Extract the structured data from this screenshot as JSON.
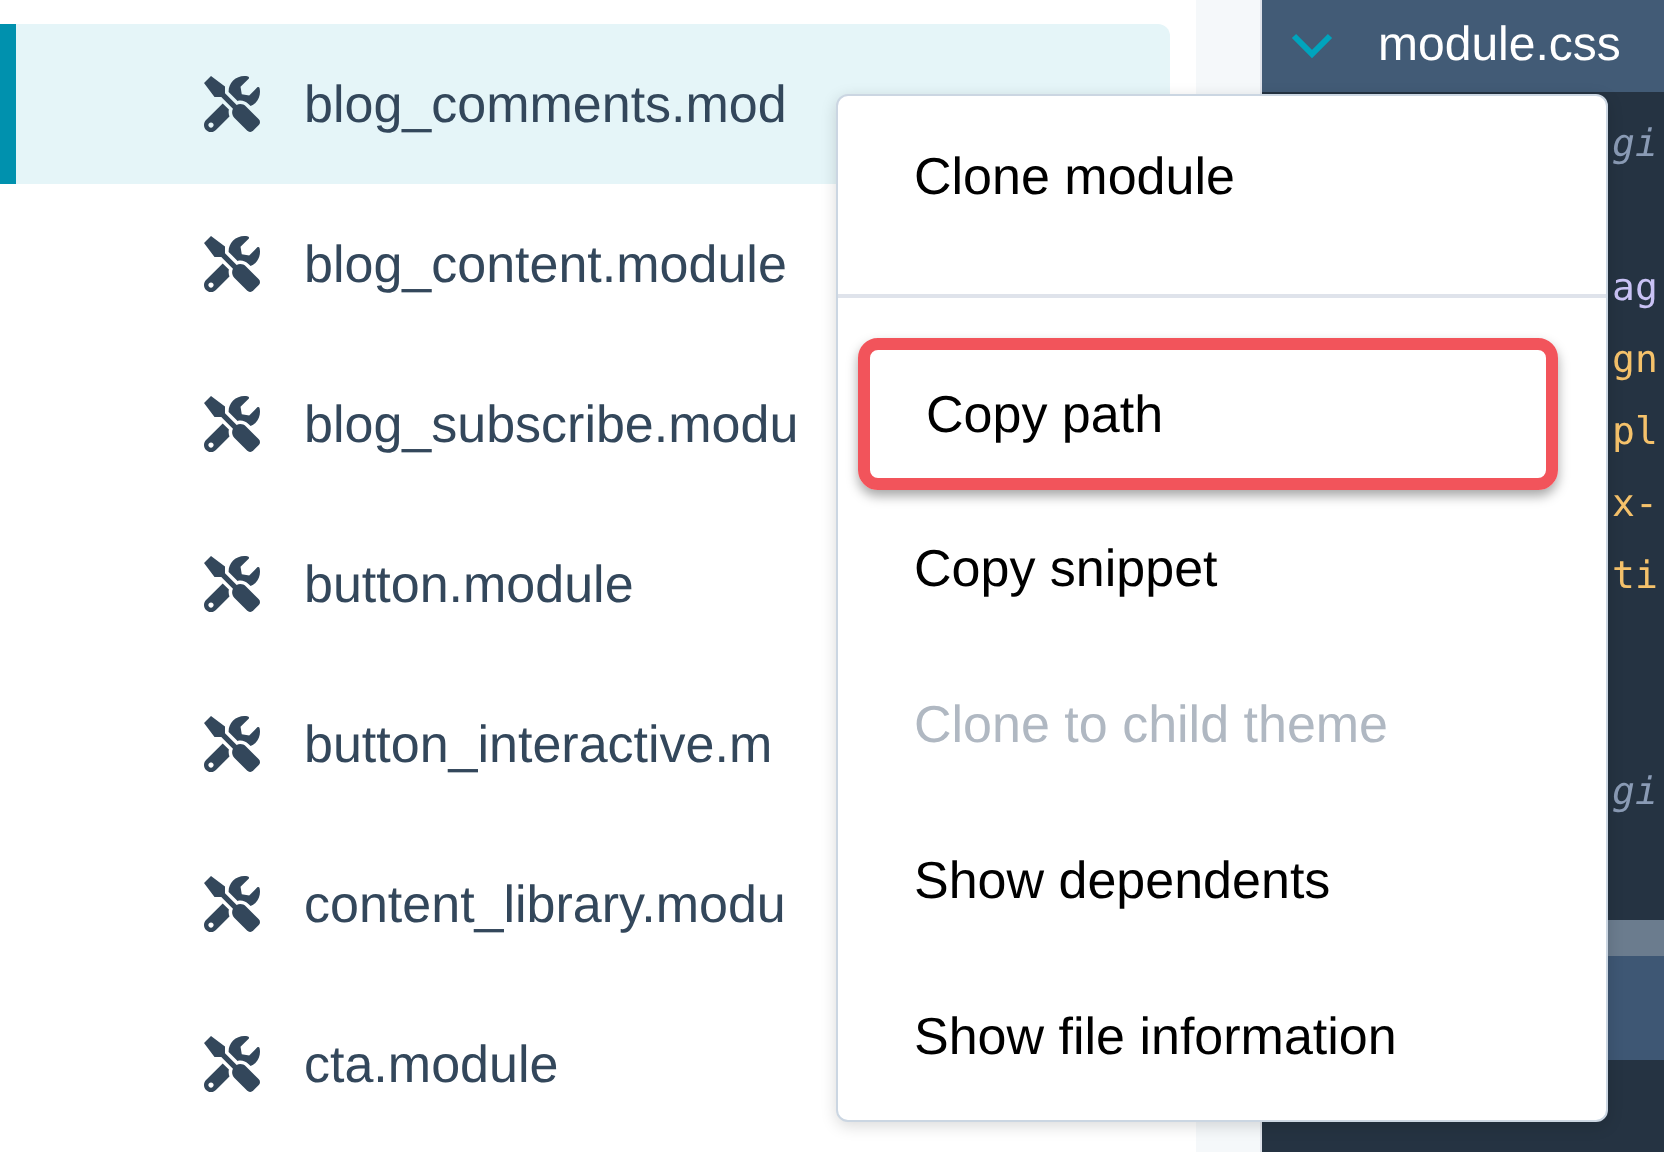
{
  "files": [
    {
      "name": "blog_comments.mod",
      "selected": true
    },
    {
      "name": "blog_content.module",
      "selected": false
    },
    {
      "name": "blog_subscribe.modu",
      "selected": false
    },
    {
      "name": "button.module",
      "selected": false
    },
    {
      "name": "button_interactive.m",
      "selected": false
    },
    {
      "name": "content_library.modu",
      "selected": false
    },
    {
      "name": "cta.module",
      "selected": false
    }
  ],
  "editor": {
    "tab": {
      "label": "module.css",
      "expanded": true
    },
    "lines": [
      {
        "kind": "comment",
        "text": "gi"
      },
      {
        "kind": "blank"
      },
      {
        "kind": "selector",
        "text": "ag"
      },
      {
        "kind": "value",
        "text": "gn"
      },
      {
        "kind": "value",
        "text": "pl"
      },
      {
        "kind": "value",
        "text": "x-"
      },
      {
        "kind": "value",
        "text": "ti"
      },
      {
        "kind": "blank"
      },
      {
        "kind": "blank"
      },
      {
        "kind": "comment",
        "text": "gi"
      }
    ]
  },
  "context_menu": {
    "items": [
      {
        "kind": "item",
        "label": "Clone module",
        "disabled": false,
        "highlighted": false
      },
      {
        "kind": "divider"
      },
      {
        "kind": "item",
        "label": "Copy path",
        "disabled": false,
        "highlighted": true
      },
      {
        "kind": "item",
        "label": "Copy snippet",
        "disabled": false,
        "highlighted": false
      },
      {
        "kind": "item",
        "label": "Clone to child theme",
        "disabled": true,
        "highlighted": false
      },
      {
        "kind": "item",
        "label": "Show dependents",
        "disabled": false,
        "highlighted": false
      },
      {
        "kind": "item",
        "label": "Show file information",
        "disabled": false,
        "highlighted": false
      }
    ]
  }
}
